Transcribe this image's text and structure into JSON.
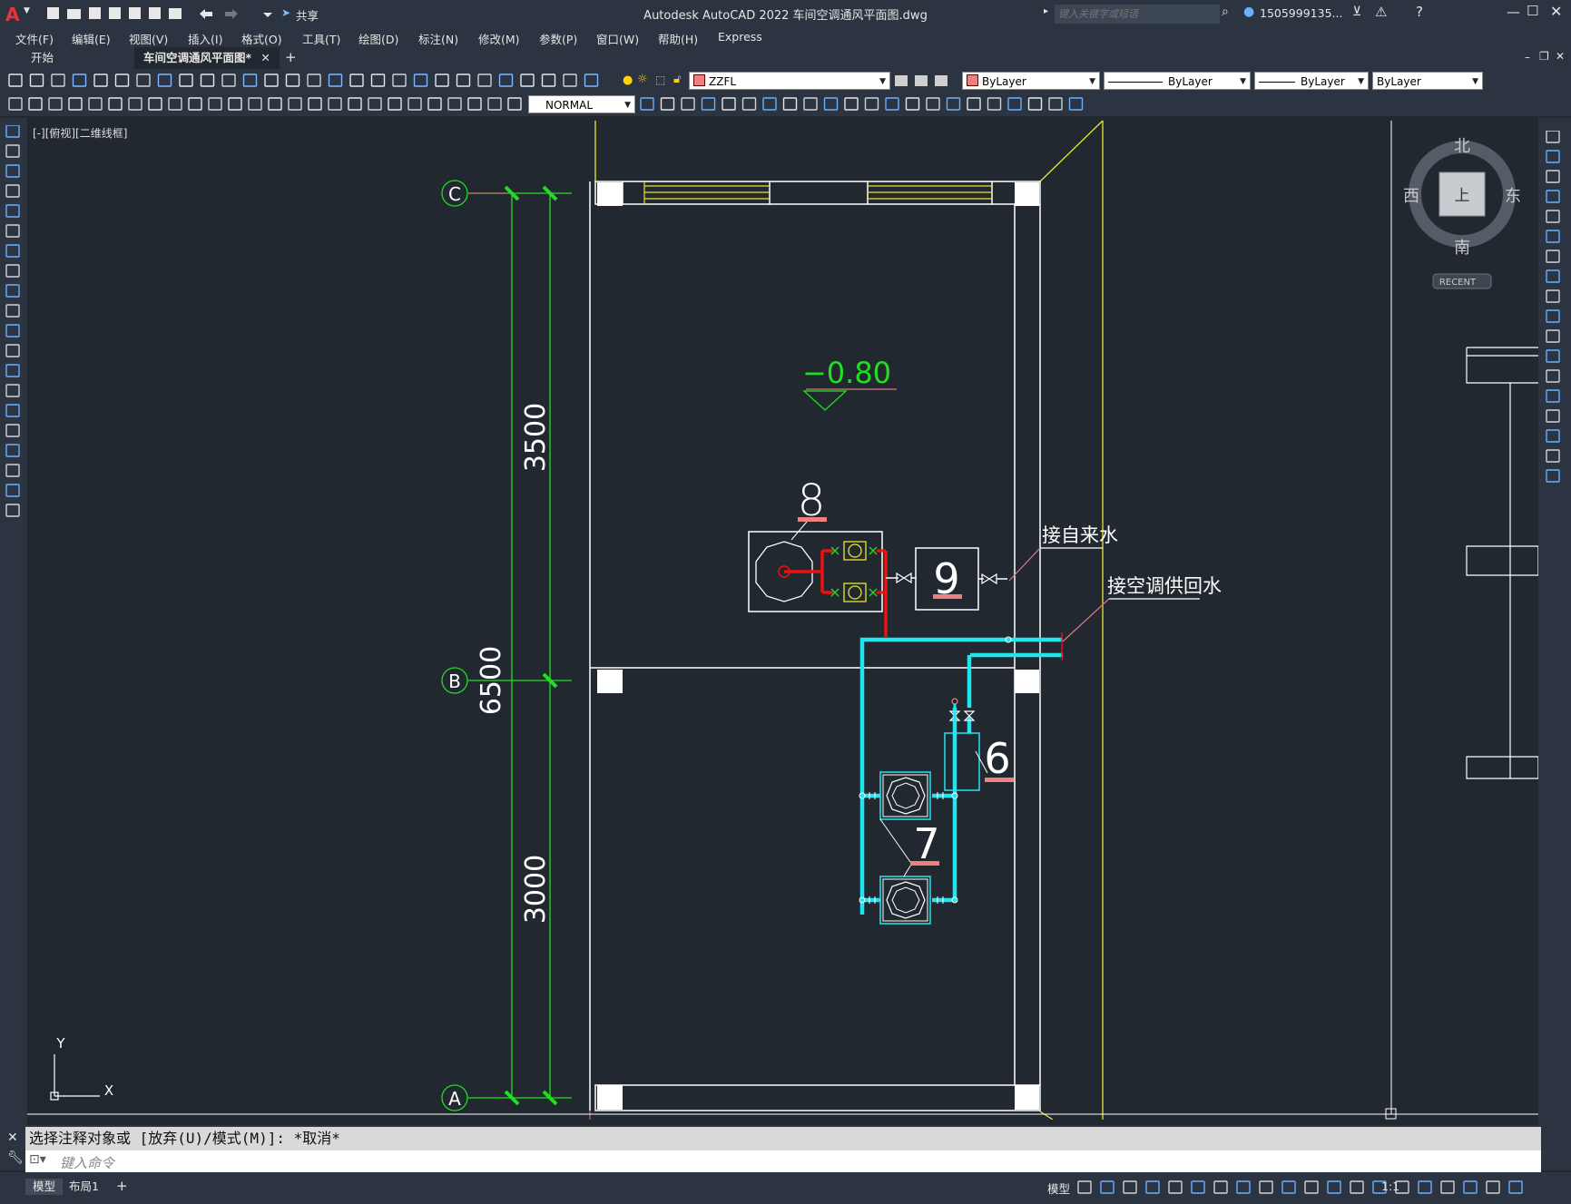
{
  "app": {
    "title": "Autodesk AutoCAD 2022    车间空调通风平面图.dwg",
    "share_label": "共享",
    "search_placeholder": "键入关键字或短语",
    "user": "1505999135..."
  },
  "menu": [
    "文件(F)",
    "编辑(E)",
    "视图(V)",
    "插入(I)",
    "格式(O)",
    "工具(T)",
    "绘图(D)",
    "标注(N)",
    "修改(M)",
    "参数(P)",
    "窗口(W)",
    "帮助(H)",
    "Express"
  ],
  "tabs": {
    "start": "开始",
    "active": "车间空调通风平面图*"
  },
  "toolbar": {
    "layer": "ZZFL",
    "color": "ByLayer",
    "linetype": "ByLayer",
    "lineweight": "ByLayer",
    "plotstyle": "ByLayer",
    "dimstyle": "NORMAL"
  },
  "viewport": {
    "label": "[-][俯视][二维线框]"
  },
  "viewcube": {
    "north": "北",
    "south": "南",
    "west": "西",
    "east": "东",
    "face": "上",
    "recent": "RECENT"
  },
  "drawing": {
    "axes": [
      "C",
      "B",
      "A"
    ],
    "dims": {
      "top_span": "3500",
      "total": "6500",
      "bottom_span": "3000"
    },
    "elevation": "−0.80",
    "equipment": [
      "8",
      "9",
      "6",
      "7"
    ],
    "notes": {
      "water_supply": "接自来水",
      "ac_water": "接空调供回水"
    },
    "ucs": {
      "x": "X",
      "y": "Y"
    },
    "colors": {
      "grid": "#22dd22",
      "wall": "#ffffff",
      "pipe_supply": "#22e5f0",
      "pipe_red": "#ee1111",
      "yellow": "#e6e62e",
      "label_bar": "#f08080"
    }
  },
  "command": {
    "history": "选择注释对象或 [放弃(U)/模式(M)]: *取消*",
    "placeholder": "键入命令"
  },
  "status": {
    "model_tab": "模型",
    "layout_tab": "布局1",
    "model_btn": "模型",
    "scale": "1:1"
  }
}
